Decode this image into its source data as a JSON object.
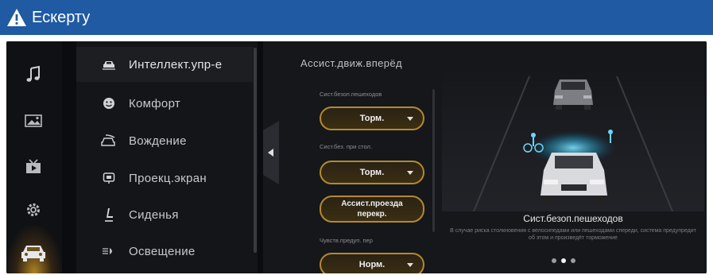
{
  "banner": {
    "title": "Ескерту",
    "icon": "warning-icon"
  },
  "rail": [
    {
      "icon": "music-note-icon"
    },
    {
      "icon": "gallery-icon"
    },
    {
      "icon": "video-icon"
    },
    {
      "icon": "gear-icon"
    },
    {
      "icon": "car-icon",
      "active": true
    }
  ],
  "menu": {
    "items": [
      {
        "label": "Интеллект.упр-е",
        "icon": "smart-drive-icon",
        "active": true
      },
      {
        "label": "Комфорт",
        "icon": "comfort-icon"
      },
      {
        "label": "Вождение",
        "icon": "driving-icon"
      },
      {
        "label": "Проекц.экран",
        "icon": "projection-screen-icon"
      },
      {
        "label": "Сиденья",
        "icon": "seat-icon"
      },
      {
        "label": "Освещение",
        "icon": "lighting-icon"
      }
    ]
  },
  "content": {
    "title": "Ассист.движ.вперёд",
    "settings": [
      {
        "label": "Сист.безоп.пешеходов",
        "value": "Торм."
      },
      {
        "label": "Сист.без. при стол.",
        "value": "Торм."
      },
      {
        "label": "",
        "value": "Ассист.проезда перекр."
      },
      {
        "label": "Чувств.предуп. пер",
        "value": "Норм."
      }
    ]
  },
  "illustration": {
    "title": "Сист.безоп.пешеходов",
    "description": "В случае риска столкновения с велосипедами или пешеходами спереди, система предупредит об этом и произведёт торможение",
    "page_dots": 3,
    "active_dot": 2
  },
  "colors": {
    "banner": "#1f5aa3",
    "accent": "#b48a2c",
    "background": "#0b0c0f"
  }
}
